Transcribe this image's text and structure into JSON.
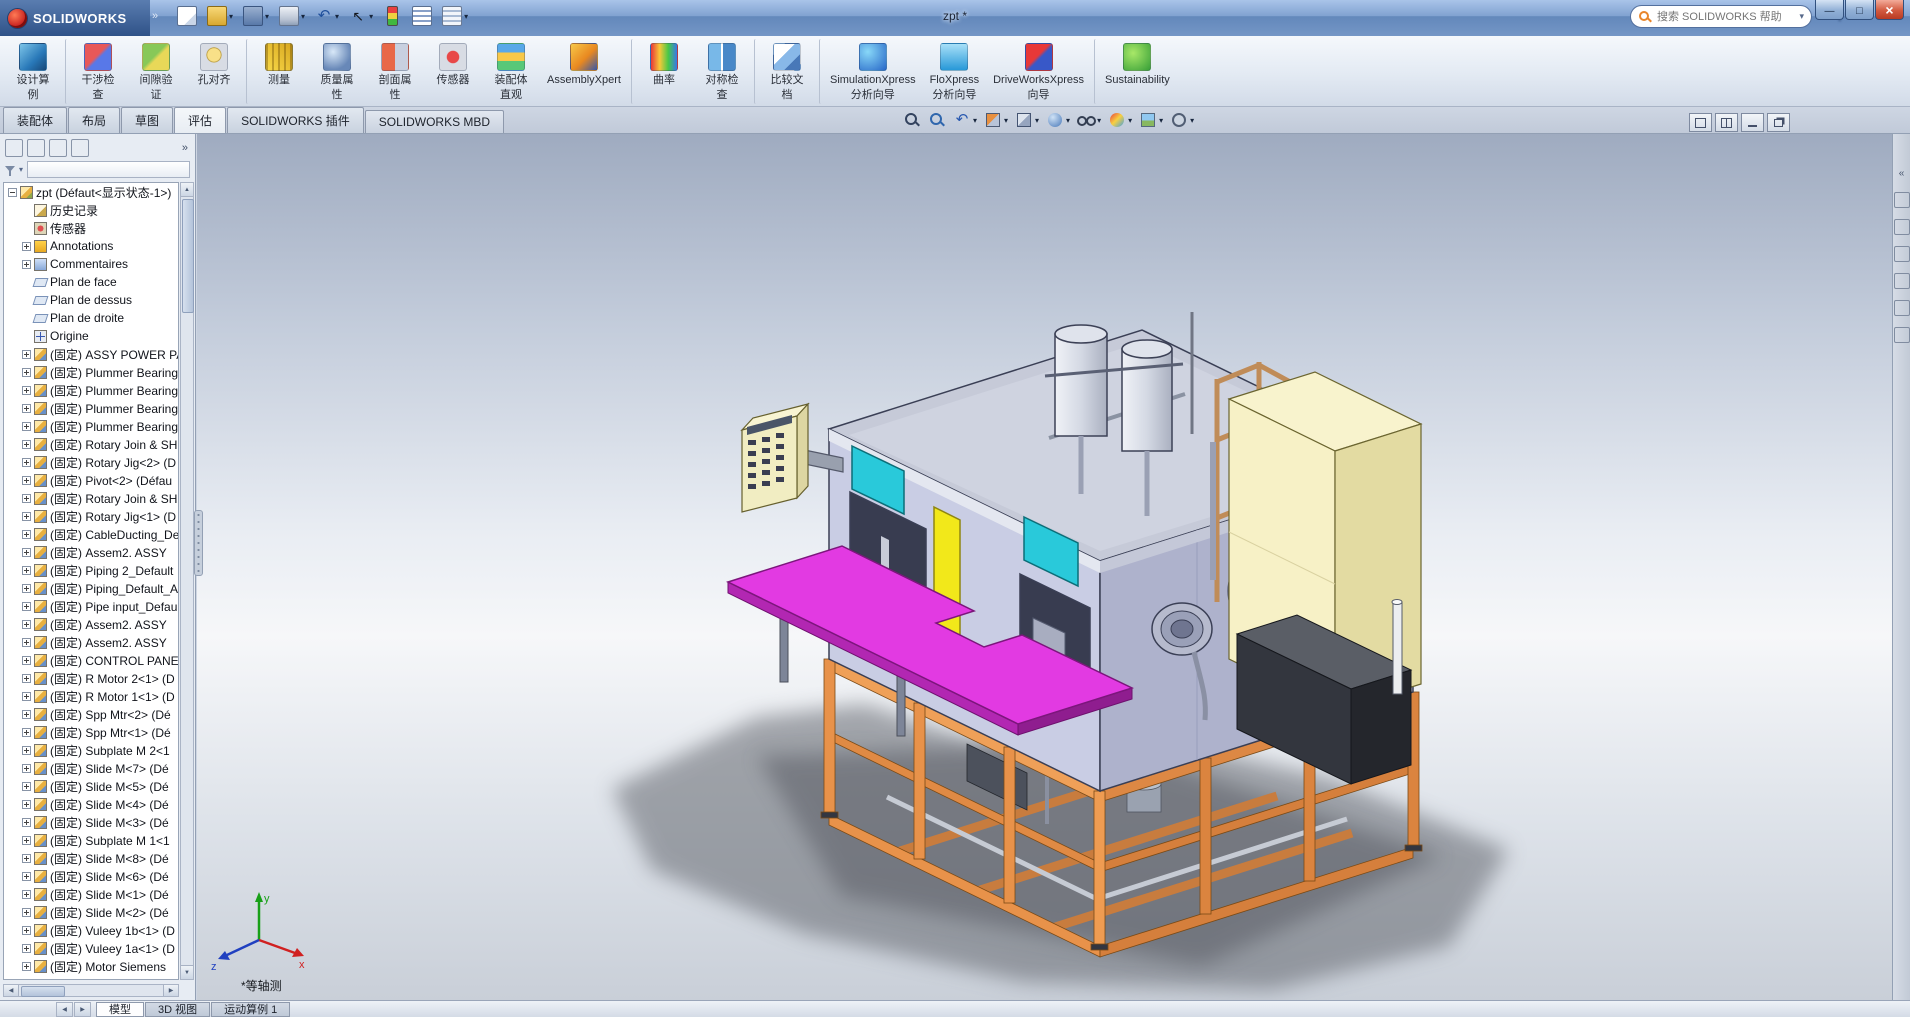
{
  "titlebar": {
    "brand": "SOLIDWORKS",
    "doc_title": "zpt *",
    "search_placeholder": "搜索 SOLIDWORKS 帮助",
    "toolbar": [
      {
        "icon": "new-document"
      },
      {
        "icon": "open-folder",
        "cls": "chev"
      },
      {
        "icon": "save",
        "cls": "chev"
      },
      {
        "icon": "print",
        "cls": "chev"
      },
      {
        "icon": "undo",
        "cls": "chev"
      },
      {
        "icon": "select-cursor",
        "cls": "chev"
      },
      {
        "icon": "rebuild"
      },
      {
        "icon": "file-properties"
      },
      {
        "icon": "options-list",
        "cls": "chev"
      }
    ]
  },
  "ribbon": {
    "buttons": [
      {
        "l1": "设计算",
        "l2": "例",
        "icon": "design-study"
      },
      {
        "l1": "干涉检",
        "l2": "查",
        "icon": "interference-check",
        "cls": "sep"
      },
      {
        "l1": "间隙验",
        "l2": "证",
        "icon": "clearance-verify"
      },
      {
        "l1": "孔对齐",
        "l2": "",
        "icon": "hole-alignment"
      },
      {
        "l1": "测量",
        "l2": "",
        "icon": "measure",
        "cls": "sep"
      },
      {
        "l1": "质量属",
        "l2": "性",
        "icon": "mass-properties"
      },
      {
        "l1": "剖面属",
        "l2": "性",
        "icon": "section-properties"
      },
      {
        "l1": "传感器",
        "l2": "",
        "icon": "sensor"
      },
      {
        "l1": "装配体",
        "l2": "直观",
        "icon": "assembly-visualization"
      },
      {
        "l1": "AssemblyXpert",
        "l2": "",
        "icon": "assemblyxpert"
      },
      {
        "l1": "曲率",
        "l2": "",
        "icon": "curvature",
        "cls": "sep"
      },
      {
        "l1": "对称检",
        "l2": "查",
        "icon": "symmetry-check"
      },
      {
        "l1": "比较文",
        "l2": "档",
        "icon": "compare-documents",
        "cls": "sep"
      },
      {
        "l1": "SimulationXpress",
        "l2": "分析向导",
        "icon": "simulationxpress",
        "cls": "sep"
      },
      {
        "l1": "FloXpress",
        "l2": "分析向导",
        "icon": "floxpress"
      },
      {
        "l1": "DriveWorksXpress",
        "l2": "向导",
        "icon": "driveworksxpress"
      },
      {
        "l1": "Sustainability",
        "l2": "",
        "icon": "sustainability",
        "cls": "sep"
      }
    ]
  },
  "tabs": {
    "items": [
      {
        "label": "装配体"
      },
      {
        "label": "布局"
      },
      {
        "label": "草图"
      },
      {
        "label": "评估",
        "cls": "active"
      },
      {
        "label": "SOLIDWORKS 插件"
      },
      {
        "label": "SOLIDWORKS MBD"
      }
    ]
  },
  "headsup": {
    "items": [
      {
        "icon": "zoom-fit"
      },
      {
        "icon": "zoom-area"
      },
      {
        "icon": "previous-view",
        "cls": "chev"
      },
      {
        "icon": "section-view",
        "cls": "chev"
      },
      {
        "icon": "view-orientation",
        "cls": "chev"
      },
      {
        "icon": "display-style",
        "cls": "chev"
      },
      {
        "icon": "hide-show-items",
        "cls": "chev"
      },
      {
        "icon": "edit-appearance",
        "cls": "chev"
      },
      {
        "icon": "apply-scene",
        "cls": "chev"
      },
      {
        "icon": "view-settings",
        "cls": "chev"
      }
    ]
  },
  "window_buttons": {
    "items": [
      {
        "icon": "viewport-single"
      },
      {
        "icon": "viewport-split"
      },
      {
        "icon": "doc-minimize"
      },
      {
        "icon": "doc-restore"
      }
    ]
  },
  "fm": {
    "overflow": "»",
    "tabs": [
      {
        "icon": "feature-manager-tree"
      },
      {
        "icon": "property-manager"
      },
      {
        "icon": "configuration-manager"
      },
      {
        "icon": "display-manager"
      }
    ]
  },
  "tree": {
    "root": "zpt  (Défaut<显示状态-1>)",
    "items": [
      {
        "label": "历史记录",
        "icon": "history",
        "cls": "noexp"
      },
      {
        "label": "传感器",
        "icon": "sensors",
        "cls": "noexp"
      },
      {
        "label": "Annotations",
        "icon": "annotations"
      },
      {
        "label": "Commentaires",
        "icon": "comments"
      },
      {
        "label": "Plan de face",
        "icon": "plane",
        "cls": "noexp"
      },
      {
        "label": "Plan de dessus",
        "icon": "plane",
        "cls": "noexp"
      },
      {
        "label": "Plan de droite",
        "icon": "plane",
        "cls": "noexp"
      },
      {
        "label": "Origine",
        "icon": "origin",
        "cls": "noexp"
      },
      {
        "label": "(固定) ASSY POWER PA",
        "icon": "component"
      },
      {
        "label": "(固定) Plummer Bearing",
        "icon": "component"
      },
      {
        "label": "(固定) Plummer Bearing",
        "icon": "component"
      },
      {
        "label": "(固定) Plummer Bearing",
        "icon": "component"
      },
      {
        "label": "(固定) Plummer Bearing",
        "icon": "component"
      },
      {
        "label": "(固定) Rotary Join & SH",
        "icon": "component"
      },
      {
        "label": "(固定) Rotary Jig<2> (D",
        "icon": "component"
      },
      {
        "label": "(固定) Pivot<2> (Défau",
        "icon": "component"
      },
      {
        "label": "(固定) Rotary Join & SH",
        "icon": "component"
      },
      {
        "label": "(固定) Rotary Jig<1> (D",
        "icon": "component"
      },
      {
        "label": "(固定) CableDucting_De",
        "icon": "component"
      },
      {
        "label": "(固定) Assem2. ASSY",
        "icon": "component"
      },
      {
        "label": "(固定) Piping 2_Default",
        "icon": "component"
      },
      {
        "label": "(固定) Piping_Default_A",
        "icon": "component"
      },
      {
        "label": "(固定) Pipe input_Defau",
        "icon": "component"
      },
      {
        "label": "(固定) Assem2. ASSY",
        "icon": "component"
      },
      {
        "label": "(固定) Assem2. ASSY",
        "icon": "component"
      },
      {
        "label": "(固定) CONTROL PANE",
        "icon": "component"
      },
      {
        "label": "(固定) R Motor 2<1> (D",
        "icon": "component"
      },
      {
        "label": "(固定) R Motor 1<1> (D",
        "icon": "component"
      },
      {
        "label": "(固定) Spp Mtr<2> (Dé",
        "icon": "component"
      },
      {
        "label": "(固定) Spp Mtr<1> (Dé",
        "icon": "component"
      },
      {
        "label": "(固定) Subplate M 2<1",
        "icon": "component"
      },
      {
        "label": "(固定) Slide M<7> (Dé",
        "icon": "component"
      },
      {
        "label": "(固定) Slide M<5> (Dé",
        "icon": "component"
      },
      {
        "label": "(固定) Slide M<4> (Dé",
        "icon": "component"
      },
      {
        "label": "(固定) Slide M<3> (Dé",
        "icon": "component"
      },
      {
        "label": "(固定) Subplate M 1<1",
        "icon": "component"
      },
      {
        "label": "(固定) Slide M<8> (Dé",
        "icon": "component"
      },
      {
        "label": "(固定) Slide M<6> (Dé",
        "icon": "component"
      },
      {
        "label": "(固定) Slide M<1> (Dé",
        "icon": "component"
      },
      {
        "label": "(固定) Slide M<2> (Dé",
        "icon": "component"
      },
      {
        "label": "(固定) Vuleey 1b<1> (D",
        "icon": "component"
      },
      {
        "label": "(固定) Vuleey 1a<1> (D",
        "icon": "component"
      },
      {
        "label": "(固定) Motor Siemens",
        "icon": "component"
      }
    ]
  },
  "taskpane": {
    "collapse": "«",
    "items": [
      {
        "icon": "solidworks-resources"
      },
      {
        "icon": "design-library"
      },
      {
        "icon": "file-explorer"
      },
      {
        "icon": "view-palette"
      },
      {
        "icon": "appearances-scenes"
      },
      {
        "icon": "custom-properties"
      }
    ]
  },
  "bottom": {
    "tabs": [
      {
        "label": "模型",
        "cls": "active"
      },
      {
        "label": "3D 视图"
      },
      {
        "label": "运动算例 1"
      }
    ]
  },
  "viewport": {
    "view_label": "*等轴测",
    "triad": {
      "x": "x",
      "y": "y",
      "z": "z"
    },
    "colors": {
      "roof": "#c6cad8",
      "housing_front": "#c9cde4",
      "housing_side": "#aeb2cc",
      "window": "#29c9da",
      "strip": "#f2e81a",
      "deck": "#e23ae2",
      "frame": "#e8924a",
      "cabinet": "#f7f1c6",
      "dark_box": "#33363e",
      "tank": "#dfe3ec"
    }
  }
}
